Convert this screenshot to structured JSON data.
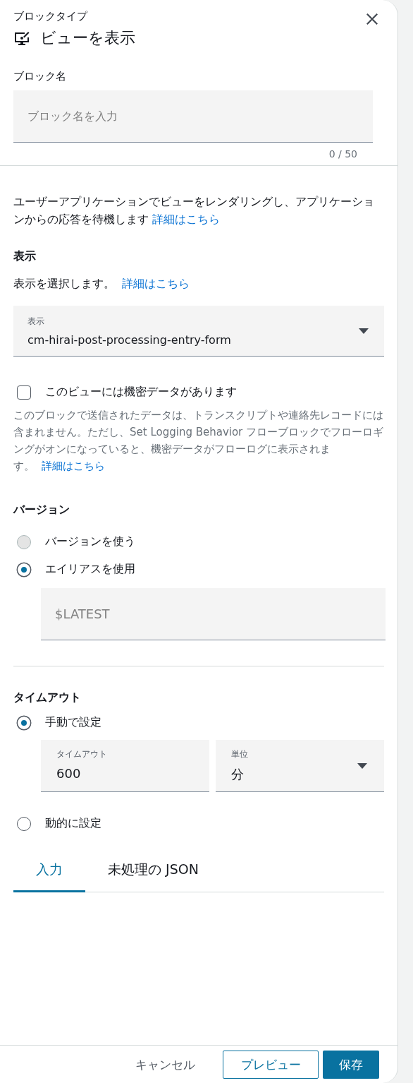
{
  "header": {
    "caption": "ブロックタイプ",
    "title": "ビューを表示"
  },
  "block_name": {
    "label": "ブロック名",
    "placeholder": "ブロック名を入力",
    "counter": "0 / 50"
  },
  "description": {
    "text": "ユーザーアプリケーションでビューをレンダリングし、アプリケーションからの応答を待機します",
    "link": "詳細はこちら"
  },
  "display": {
    "heading": "表示",
    "text": "表示を選択します。",
    "link": "詳細はこちら",
    "select_label": "表示",
    "select_value": "cm-hirai-post-processing-entry-form"
  },
  "sensitive": {
    "label": "このビューには機密データがあります",
    "checked": false,
    "help": "このブロックで送信されたデータは、トランスクリプトや連絡先レコードには含まれません。ただし、Set Logging Behavior フローブロックでフローロギングがオンになっていると、機密データがフローログに表示されます。",
    "link": "詳細はこちら"
  },
  "version": {
    "heading": "バージョン",
    "options": [
      {
        "label": "バージョンを使う",
        "selected": false,
        "disabled": true
      },
      {
        "label": "エイリアスを使用",
        "selected": true,
        "disabled": false
      }
    ],
    "alias_placeholder": "$LATEST"
  },
  "timeout": {
    "heading": "タイムアウト",
    "options": [
      {
        "label": "手動で設定",
        "selected": true,
        "disabled": false
      },
      {
        "label": "動的に設定",
        "selected": false,
        "disabled": false
      }
    ],
    "value_label": "タイムアウト",
    "value": "600",
    "unit_label": "単位",
    "unit": "分"
  },
  "tabs": [
    {
      "label": "入力",
      "selected": true
    },
    {
      "label": "未処理の JSON",
      "selected": false
    }
  ],
  "footer": {
    "cancel": "キャンセル",
    "preview": "プレビュー",
    "save": "保存"
  }
}
